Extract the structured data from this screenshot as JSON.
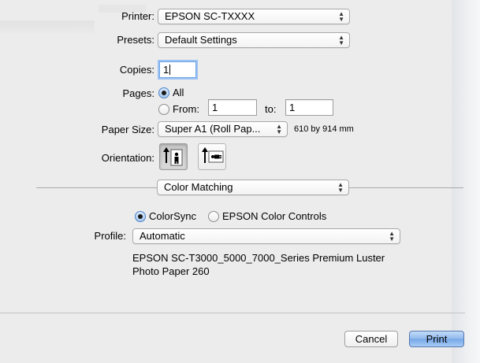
{
  "printer": {
    "label": "Printer:",
    "value": "EPSON SC-TXXXX"
  },
  "presets": {
    "label": "Presets:",
    "value": "Default Settings"
  },
  "copies": {
    "label": "Copies:",
    "value": "1"
  },
  "pages": {
    "label": "Pages:",
    "all_label": "All",
    "from_label": "From:",
    "from_value": "1",
    "to_label": "to:",
    "to_value": "1",
    "selected": "All"
  },
  "paper_size": {
    "label": "Paper Size:",
    "value": "Super A1 (Roll Pap...",
    "dimensions": "610 by 914 mm"
  },
  "orientation": {
    "label": "Orientation:",
    "options": [
      "portrait-icon",
      "landscape-icon"
    ],
    "selected": "portrait-icon"
  },
  "section": {
    "value": "Color Matching"
  },
  "color_matching": {
    "option_colorsync": "ColorSync",
    "option_epson": "EPSON Color Controls",
    "selected": "ColorSync"
  },
  "profile": {
    "label": "Profile:",
    "value": "Automatic",
    "description_line1": "EPSON SC-T3000_5000_7000_Series Premium Luster",
    "description_line2": "Photo Paper 260"
  },
  "buttons": {
    "cancel": "Cancel",
    "print": "Print"
  },
  "colors": {
    "accent": "#7fb0ec",
    "focus": "#9cc2f2",
    "window_bg": "#ececec"
  }
}
